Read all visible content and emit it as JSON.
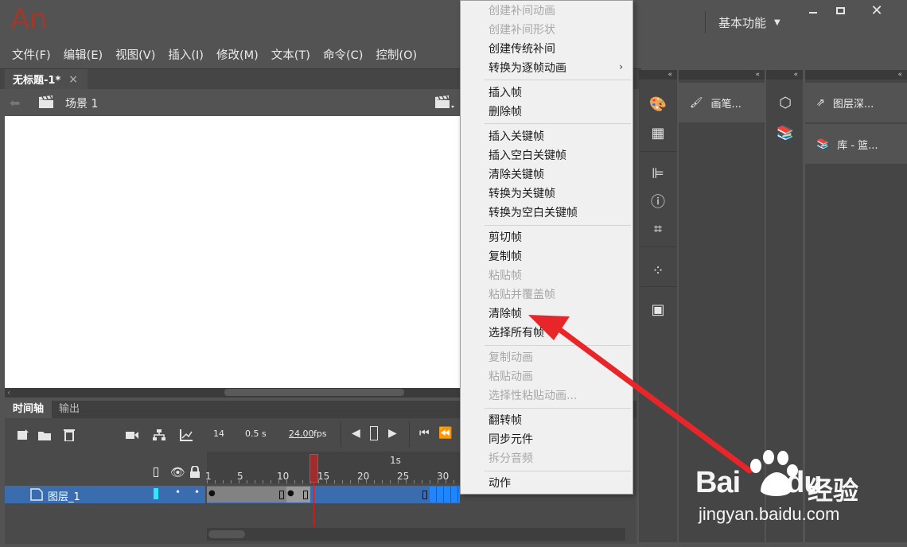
{
  "app": {
    "logo": "An",
    "workspace": "基本功能"
  },
  "menubar": [
    "文件(F)",
    "编辑(E)",
    "视图(V)",
    "插入(I)",
    "修改(M)",
    "文本(T)",
    "命令(C)",
    "控制(O)"
  ],
  "document": {
    "tab_title": "无标题-1*",
    "close_glyph": "×",
    "scene": "场景 1"
  },
  "timeline": {
    "tabs": [
      "时间轴",
      "输出"
    ],
    "current_frame": "14",
    "elapsed": "0.5 s",
    "fps_value": "24.00",
    "fps_unit": "fps",
    "ruler_second_label": "1s",
    "ruler_labels": [
      "1",
      "5",
      "10",
      "15",
      "20",
      "25",
      "30"
    ],
    "layer_name": "图层_1"
  },
  "dock": {
    "brush_panel": "画笔...",
    "layer_depth_panel": "图层深...",
    "library_panel": "库 - 篮..."
  },
  "context_menu": {
    "items": [
      {
        "label": "创建补间动画",
        "disabled": true
      },
      {
        "label": "创建补间形状",
        "disabled": true
      },
      {
        "label": "创建传统补间",
        "disabled": false
      },
      {
        "label": "转换为逐帧动画",
        "disabled": false,
        "submenu": true
      },
      {
        "label": "插入帧",
        "disabled": false
      },
      {
        "label": "删除帧",
        "disabled": false
      },
      {
        "label": "插入关键帧",
        "disabled": false
      },
      {
        "label": "插入空白关键帧",
        "disabled": false
      },
      {
        "label": "清除关键帧",
        "disabled": false
      },
      {
        "label": "转换为关键帧",
        "disabled": false
      },
      {
        "label": "转换为空白关键帧",
        "disabled": false
      },
      {
        "label": "剪切帧",
        "disabled": false
      },
      {
        "label": "复制帧",
        "disabled": false
      },
      {
        "label": "粘贴帧",
        "disabled": true
      },
      {
        "label": "粘贴并覆盖帧",
        "disabled": true
      },
      {
        "label": "清除帧",
        "disabled": false
      },
      {
        "label": "选择所有帧",
        "disabled": false
      },
      {
        "label": "复制动画",
        "disabled": true
      },
      {
        "label": "粘贴动画",
        "disabled": true
      },
      {
        "label": "选择性粘贴动画...",
        "disabled": true
      },
      {
        "label": "翻转帧",
        "disabled": false
      },
      {
        "label": "同步元件",
        "disabled": false
      },
      {
        "label": "拆分音频",
        "disabled": true
      },
      {
        "label": "动作",
        "disabled": false
      }
    ],
    "submenu_glyph": "›"
  },
  "watermark": {
    "brand": "Bai",
    "brand2": "du",
    "cn": "经验",
    "url": "jingyan.baidu.com"
  },
  "colors": {
    "accent": "#3a6cb0",
    "arrow": "#e8262a",
    "logo": "#9c3a2c"
  }
}
